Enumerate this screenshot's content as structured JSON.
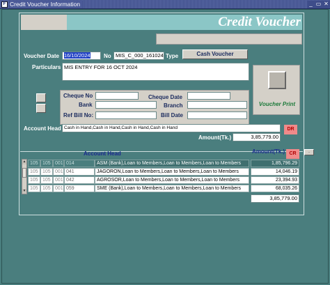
{
  "window": {
    "title": "Credit Voucher Information",
    "controls": {
      "minimize": "_",
      "maximize": "▭",
      "close": "✕"
    }
  },
  "header": {
    "banner_title": "Credit Voucher"
  },
  "voucher": {
    "date_label": "Voucher Date",
    "date_value": "16/10/2024",
    "no_label": "No",
    "no_value": "MIS_C_000_161024",
    "type_label": "Type",
    "type_value": "Cash Voucher",
    "particulars_label": "Particulars",
    "particulars_value": "MIS ENTRY FOR 16 OCT 2024"
  },
  "cheque": {
    "cheque_no_label": "Cheque No",
    "bank_label": "Bank",
    "ref_bill_label": "Ref Bill No:",
    "cheque_date_label": "Cheque Date",
    "branch_label": "Branch",
    "bill_date_label": "Bill Date",
    "cheque_no_value": "",
    "bank_value": "",
    "ref_bill_value": "",
    "cheque_date_value": "",
    "branch_value": "",
    "bill_date_value": ""
  },
  "print": {
    "label": "Voucher Print"
  },
  "debit": {
    "account_head_label": "Account Head",
    "account_head_value": "Cash in Hand,Cash in Hand,Cash in Hand,Cash in Hand",
    "amount_label": "Amount(Tk.)",
    "amount_value": "3,85,779.00",
    "badge": "DR"
  },
  "credit": {
    "account_head_header": "Account Head",
    "amount_header": "Amount(Tk.)",
    "badge": "CR",
    "rows": [
      {
        "c1": "105",
        "c2": "105",
        "c3": "001",
        "c4": "014",
        "account": "ASM (Bank),Loan to Members,Loan to Members,Loan to Members",
        "amount": "1,85,796.29"
      },
      {
        "c1": "105",
        "c2": "105",
        "c3": "001",
        "c4": "041",
        "account": "JAGORON,Loan to Members,Loan to Members,Loan to Members",
        "amount": "14,046.19"
      },
      {
        "c1": "105",
        "c2": "105",
        "c3": "001",
        "c4": "042",
        "account": "AGROSOR,Loan to Members,Loan to Members,Loan to Members",
        "amount": "23,394.93"
      },
      {
        "c1": "105",
        "c2": "105",
        "c3": "001",
        "c4": "059",
        "account": "SME (Bank),Loan to Members,Loan to Members,Loan to Members",
        "amount": "68,035.26"
      }
    ],
    "total": "3,85,779.00",
    "extra_button": "."
  }
}
